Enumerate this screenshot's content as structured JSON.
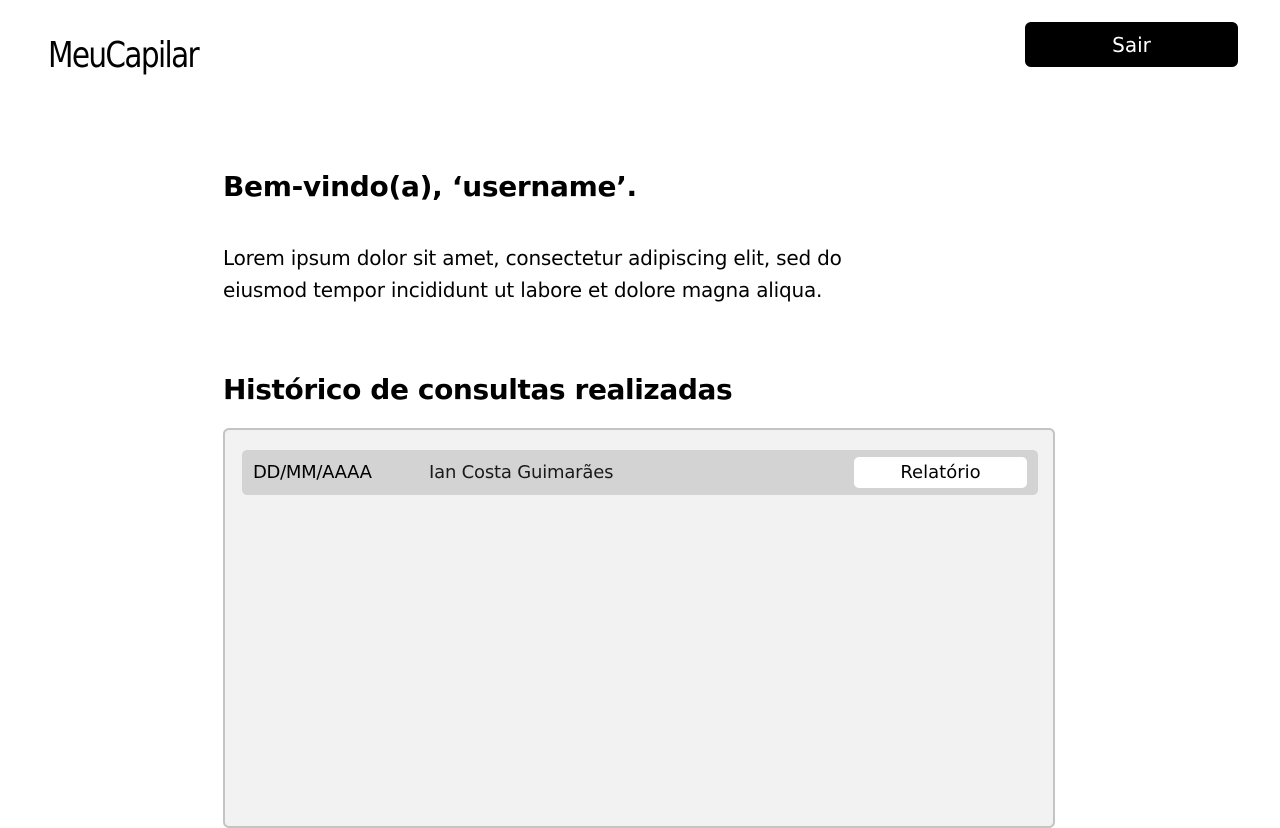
{
  "app": {
    "logo_text": "MeuCapilar"
  },
  "header": {
    "logout_label": "Sair"
  },
  "main": {
    "welcome_title": "Bem-vindo(a), ‘username’.",
    "intro_text": "Lorem ipsum dolor sit amet, consectetur adipiscing elit, sed do eiusmod tempor incididunt ut labore et dolore magna aliqua.",
    "history_title": "Histórico de consultas realizadas",
    "history": [
      {
        "date": "DD/MM/AAAA",
        "name": "Ian Costa Guimarães",
        "action_label": "Relatório"
      }
    ]
  },
  "colors": {
    "background": "#ffffff",
    "primary_button": "#000000",
    "panel_background": "#f2f2f2",
    "row_background": "#d3d3d3"
  }
}
